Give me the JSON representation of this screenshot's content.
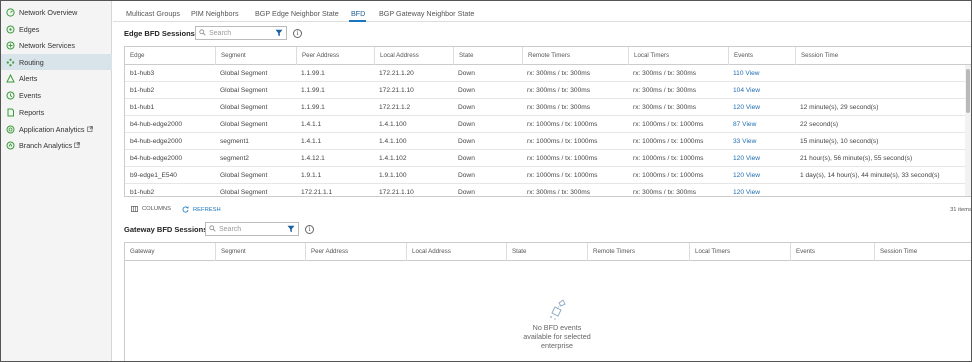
{
  "sidebar": {
    "items": [
      {
        "label": "Network Overview",
        "icon": "network-overview-icon"
      },
      {
        "label": "Edges",
        "icon": "edges-icon"
      },
      {
        "label": "Network Services",
        "icon": "network-services-icon"
      },
      {
        "label": "Routing",
        "icon": "routing-icon",
        "active": true
      },
      {
        "label": "Alerts",
        "icon": "alerts-icon"
      },
      {
        "label": "Events",
        "icon": "events-icon"
      },
      {
        "label": "Reports",
        "icon": "reports-icon"
      },
      {
        "label": "Application Analytics",
        "icon": "analytics-icon",
        "external": true
      },
      {
        "label": "Branch Analytics",
        "icon": "branch-analytics-icon",
        "external": true
      }
    ]
  },
  "tabs": [
    "Multicast Groups",
    "PIM Neighbors",
    "BGP Edge Neighbor State",
    "BFD",
    "BGP Gateway Neighbor State"
  ],
  "active_tab": "BFD",
  "edge_section": {
    "title": "Edge BFD Sessions",
    "search_placeholder": "Search",
    "columns": [
      "Edge",
      "Segment",
      "Peer Address",
      "Local Address",
      "State",
      "Remote Timers",
      "Local Timers",
      "Events",
      "Session Time"
    ],
    "rows": [
      [
        "b1-hub3",
        "Global Segment",
        "1.1.99.1",
        "172.21.1.20",
        "Down",
        "rx: 300ms / tx: 300ms",
        "rx: 300ms / tx: 300ms",
        "110 View",
        ""
      ],
      [
        "b1-hub2",
        "Global Segment",
        "1.1.99.1",
        "172.21.1.10",
        "Down",
        "rx: 300ms / tx: 300ms",
        "rx: 300ms / tx: 300ms",
        "104 View",
        ""
      ],
      [
        "b1-hub1",
        "Global Segment",
        "1.1.99.1",
        "172.21.1.2",
        "Down",
        "rx: 300ms / tx: 300ms",
        "rx: 300ms / tx: 300ms",
        "120 View",
        "12 minute(s), 29 second(s)"
      ],
      [
        "b4-hub-edge2000",
        "Global Segment",
        "1.4.1.1",
        "1.4.1.100",
        "Down",
        "rx: 1000ms / tx: 1000ms",
        "rx: 1000ms / tx: 1000ms",
        "87 View",
        "22 second(s)"
      ],
      [
        "b4-hub-edge2000",
        "segment1",
        "1.4.1.1",
        "1.4.1.100",
        "Down",
        "rx: 1000ms / tx: 1000ms",
        "rx: 1000ms / tx: 1000ms",
        "33 View",
        "15 minute(s), 10 second(s)"
      ],
      [
        "b4-hub-edge2000",
        "segment2",
        "1.4.12.1",
        "1.4.1.102",
        "Down",
        "rx: 1000ms / tx: 1000ms",
        "rx: 1000ms / tx: 1000ms",
        "120 View",
        "21 hour(s), 56 minute(s), 55 second(s)"
      ],
      [
        "b9-edge1_E540",
        "Global Segment",
        "1.9.1.1",
        "1.9.1.100",
        "Down",
        "rx: 1000ms / tx: 1000ms",
        "rx: 1000ms / tx: 1000ms",
        "120 View",
        "1 day(s), 14 hour(s), 44 minute(s), 33 second(s)"
      ],
      [
        "b1-hub2",
        "Global Segment",
        "172.21.1.1",
        "172.21.1.10",
        "Down",
        "rx: 300ms / tx: 300ms",
        "rx: 300ms / tx: 300ms",
        "120 View",
        ""
      ]
    ],
    "columns_button": "COLUMNS",
    "refresh_button": "REFRESH",
    "item_count": "31 items"
  },
  "gateway_section": {
    "title": "Gateway BFD Sessions",
    "search_placeholder": "Search",
    "columns": [
      "Gateway",
      "Segment",
      "Peer Address",
      "Local Address",
      "State",
      "Remote Timers",
      "Local Timers",
      "Events",
      "Session Time"
    ],
    "empty_lines": [
      "No BFD events",
      "available for selected",
      "enterprise"
    ]
  },
  "colors": {
    "accent": "#1b75bc",
    "link": "#1f6db3",
    "active_nav": "#d9e3ea",
    "sidebar_icon": "#3a9c3a"
  }
}
